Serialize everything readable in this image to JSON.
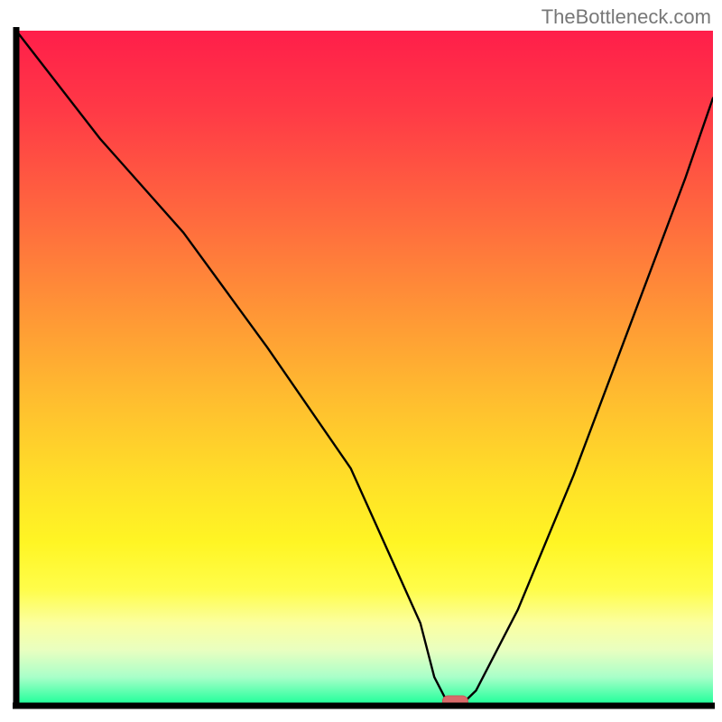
{
  "watermark": {
    "text": "TheBottleneck.com"
  },
  "chart_data": {
    "type": "line",
    "title": "",
    "xlabel": "",
    "ylabel": "",
    "xlim": [
      0,
      100
    ],
    "ylim": [
      0,
      100
    ],
    "grid": false,
    "legend": false,
    "series": [
      {
        "name": "bottleneck-curve",
        "x": [
          0,
          12,
          24,
          36,
          48,
          58,
          60,
          62,
          64,
          66,
          72,
          80,
          88,
          96,
          100
        ],
        "values": [
          100,
          84,
          70,
          53,
          35,
          12,
          4,
          0,
          0,
          2,
          14,
          34,
          56,
          78,
          90
        ],
        "comment": "y = bottleneck percentage (0 = green/ideal, 100 = red/severe). Estimated from curve silhouette against gradient."
      }
    ],
    "marker": {
      "x": 63,
      "y": 0,
      "shape": "pill",
      "name": "optimal-point"
    },
    "background_gradient": {
      "stops": [
        {
          "pct": 0,
          "color": "#ff1e4a"
        },
        {
          "pct": 50,
          "color": "#ffbe2f"
        },
        {
          "pct": 85,
          "color": "#fffd4a"
        },
        {
          "pct": 100,
          "color": "#1fff9a"
        }
      ],
      "direction": "top-to-bottom"
    }
  }
}
